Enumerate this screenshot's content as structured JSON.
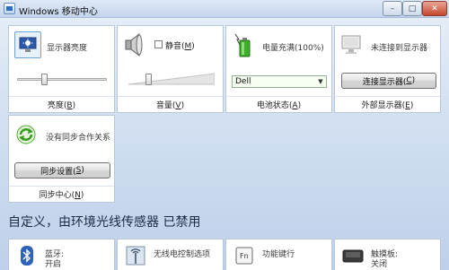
{
  "window": {
    "title": "Windows 移动中心",
    "buttons": {
      "minimize": "–",
      "maximize": "□",
      "close": "✕"
    }
  },
  "tiles": {
    "brightness": {
      "label": "显示器亮度",
      "caption": "亮度(B)",
      "caption_text": "亮度(",
      "caption_key": "B",
      "slider_value_pct": 30
    },
    "volume": {
      "mute_label_text": "静音(",
      "mute_key": "M",
      "mute_checked": false,
      "caption_text": "音量(",
      "caption_key": "V",
      "slider_value_pct": 10
    },
    "battery": {
      "label": "电量充满(100%)",
      "plan_selected": "Dell",
      "caption_text": "电池状态(",
      "caption_key": "A"
    },
    "external_display": {
      "label": "未连接到显示器",
      "button_text": "连接显示器(",
      "button_key": "C",
      "caption_text": "外部显示器(",
      "caption_key": "E"
    },
    "sync": {
      "label": "没有同步合作关系",
      "button_text": "同步设置(",
      "button_key": "S",
      "caption_text": "同步中心(",
      "caption_key": "N"
    }
  },
  "heading": "自定义，由环境光线传感器 已禁用",
  "bottom_tiles": [
    {
      "line1": "蓝牙:",
      "line2": "开启",
      "icon": "bluetooth-icon"
    },
    {
      "line1": "无线电控制选项",
      "line2": "",
      "icon": "wireless-icon"
    },
    {
      "line1": "功能键行",
      "line2": "",
      "icon": "function-key-icon"
    },
    {
      "line1": "触摸板:",
      "line2": "关闭",
      "icon": "touchpad-icon"
    }
  ],
  "colors": {
    "accent": "#2b6cc7",
    "battery_green": "#3fae2a",
    "window_bg": "#c9d8ec"
  }
}
